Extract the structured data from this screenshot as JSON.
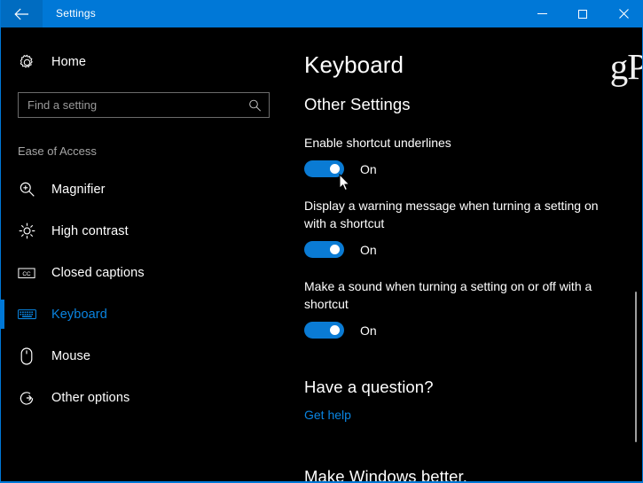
{
  "titlebar": {
    "back_icon": "back-arrow-icon",
    "title": "Settings",
    "minimize_label": "Minimize",
    "maximize_label": "Maximize",
    "close_label": "Close"
  },
  "sidebar": {
    "home": {
      "label": "Home",
      "icon": "gear-icon"
    },
    "search": {
      "value": "",
      "placeholder": "Find a setting",
      "icon": "search-icon"
    },
    "group_label": "Ease of Access",
    "items": [
      {
        "label": "Magnifier",
        "icon": "magnifier-icon",
        "selected": false
      },
      {
        "label": "High contrast",
        "icon": "brightness-icon",
        "selected": false
      },
      {
        "label": "Closed captions",
        "icon": "closed-captions-icon",
        "selected": false
      },
      {
        "label": "Keyboard",
        "icon": "keyboard-icon",
        "selected": true
      },
      {
        "label": "Mouse",
        "icon": "mouse-icon",
        "selected": false
      },
      {
        "label": "Other options",
        "icon": "other-options-icon",
        "selected": false
      }
    ]
  },
  "content": {
    "watermark": "gP",
    "page_title": "Keyboard",
    "section_title": "Other Settings",
    "settings": [
      {
        "label": "Enable shortcut underlines",
        "state": "On",
        "on": true
      },
      {
        "label": "Display a warning message when turning a setting on with a shortcut",
        "state": "On",
        "on": true
      },
      {
        "label": "Make a sound when turning a setting on or off with a shortcut",
        "state": "On",
        "on": true
      }
    ],
    "help_title": "Have a question?",
    "help_link": "Get help",
    "footer_title": "Make Windows better."
  },
  "colors": {
    "accent": "#0078d7",
    "toggle_on": "#0a7bd4",
    "link": "#0a84e0",
    "background": "#000000"
  }
}
